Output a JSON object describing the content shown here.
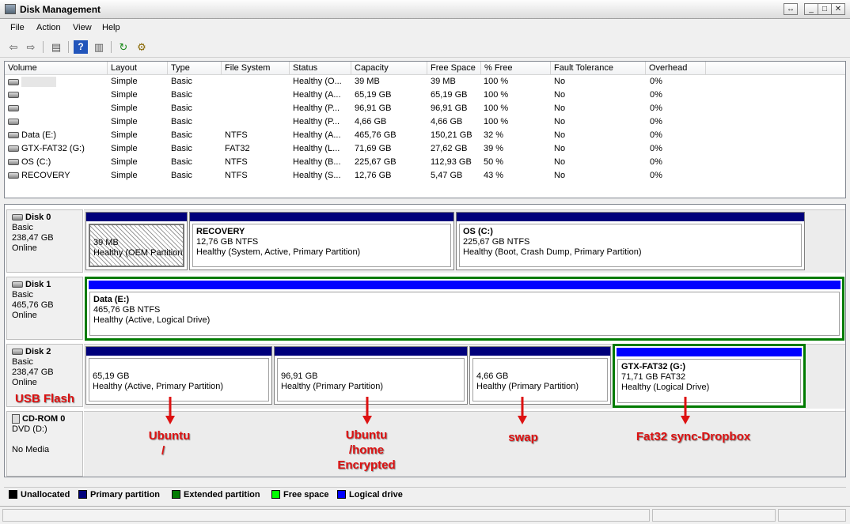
{
  "window": {
    "title": "Disk Management",
    "restore_glyph": "↔",
    "minimize_glyph": "_",
    "maximize_glyph": "□",
    "close_glyph": "✕"
  },
  "menu": [
    "File",
    "Action",
    "View",
    "Help"
  ],
  "toolbar": {
    "back_glyph": "⇦",
    "forward_glyph": "⇨",
    "console_glyph": "▤",
    "help_glyph": "?",
    "properties_glyph": "▥",
    "refresh_glyph": "↻",
    "rescan_glyph": "⚙"
  },
  "volume_table": {
    "columns": [
      "Volume",
      "Layout",
      "Type",
      "File System",
      "Status",
      "Capacity",
      "Free Space",
      "% Free",
      "Fault Tolerance",
      "Overhead"
    ],
    "rows": [
      {
        "volume": "",
        "layout": "Simple",
        "type": "Basic",
        "fs": "",
        "status": "Healthy (O...",
        "capacity": "39 MB",
        "free": "39 MB",
        "pct": "100 %",
        "fault": "No",
        "overhead": "0%"
      },
      {
        "volume": "",
        "layout": "Simple",
        "type": "Basic",
        "fs": "",
        "status": "Healthy (A...",
        "capacity": "65,19 GB",
        "free": "65,19 GB",
        "pct": "100 %",
        "fault": "No",
        "overhead": "0%"
      },
      {
        "volume": "",
        "layout": "Simple",
        "type": "Basic",
        "fs": "",
        "status": "Healthy (P...",
        "capacity": "96,91 GB",
        "free": "96,91 GB",
        "pct": "100 %",
        "fault": "No",
        "overhead": "0%"
      },
      {
        "volume": "",
        "layout": "Simple",
        "type": "Basic",
        "fs": "",
        "status": "Healthy (P...",
        "capacity": "4,66 GB",
        "free": "4,66 GB",
        "pct": "100 %",
        "fault": "No",
        "overhead": "0%"
      },
      {
        "volume": "Data (E:)",
        "layout": "Simple",
        "type": "Basic",
        "fs": "NTFS",
        "status": "Healthy (A...",
        "capacity": "465,76 GB",
        "free": "150,21 GB",
        "pct": "32 %",
        "fault": "No",
        "overhead": "0%"
      },
      {
        "volume": "GTX-FAT32 (G:)",
        "layout": "Simple",
        "type": "Basic",
        "fs": "FAT32",
        "status": "Healthy (L...",
        "capacity": "71,69 GB",
        "free": "27,62 GB",
        "pct": "39 %",
        "fault": "No",
        "overhead": "0%"
      },
      {
        "volume": "OS (C:)",
        "layout": "Simple",
        "type": "Basic",
        "fs": "NTFS",
        "status": "Healthy (B...",
        "capacity": "225,67 GB",
        "free": "112,93 GB",
        "pct": "50 %",
        "fault": "No",
        "overhead": "0%"
      },
      {
        "volume": "RECOVERY",
        "layout": "Simple",
        "type": "Basic",
        "fs": "NTFS",
        "status": "Healthy (S...",
        "capacity": "12,76 GB",
        "free": "5,47 GB",
        "pct": "43 %",
        "fault": "No",
        "overhead": "0%"
      }
    ]
  },
  "disks": [
    {
      "name": "Disk 0",
      "kind": "Basic",
      "size": "238,47 GB",
      "state": "Online",
      "partitions": [
        {
          "name": "",
          "size": "39 MB",
          "status": "Healthy (OEM Partition)"
        },
        {
          "name": "RECOVERY",
          "size": "12,76 GB NTFS",
          "status": "Healthy (System, Active, Primary Partition)"
        },
        {
          "name": "OS  (C:)",
          "size": "225,67 GB NTFS",
          "status": "Healthy (Boot, Crash Dump, Primary Partition)"
        }
      ]
    },
    {
      "name": "Disk 1",
      "kind": "Basic",
      "size": "465,76 GB",
      "state": "Online",
      "partitions": [
        {
          "name": "Data  (E:)",
          "size": "465,76 GB NTFS",
          "status": "Healthy (Active, Logical Drive)"
        }
      ]
    },
    {
      "name": "Disk 2",
      "kind": "Basic",
      "size": "238,47 GB",
      "state": "Online",
      "partitions": [
        {
          "name": "",
          "size": "65,19 GB",
          "status": "Healthy (Active, Primary Partition)"
        },
        {
          "name": "",
          "size": "96,91 GB",
          "status": "Healthy (Primary Partition)"
        },
        {
          "name": "",
          "size": "4,66 GB",
          "status": "Healthy (Primary Partition)"
        },
        {
          "name": "GTX-FAT32  (G:)",
          "size": "71,71 GB FAT32",
          "status": "Healthy (Logical Drive)"
        }
      ]
    },
    {
      "name": "CD-ROM 0",
      "kind": "DVD (D:)",
      "size": "",
      "state": "No Media",
      "partitions": []
    }
  ],
  "annotations": {
    "usb_flash": "USB Flash",
    "ubuntu_root_1": "Ubuntu",
    "ubuntu_root_2": "/",
    "ubuntu_home_1": "Ubuntu",
    "ubuntu_home_2": "/home",
    "ubuntu_home_3": "Encrypted",
    "swap": "swap",
    "fat32": "Fat32 sync-Dropbox"
  },
  "legend": [
    {
      "label": "Unallocated",
      "color": "#000000"
    },
    {
      "label": "Primary partition",
      "color": "#00007b"
    },
    {
      "label": "Extended partition",
      "color": "#007b00"
    },
    {
      "label": "Free space",
      "color": "#00ff00"
    },
    {
      "label": "Logical drive",
      "color": "#0000ff"
    }
  ],
  "colors": {
    "primary_bar": "#00007b",
    "logical_bar": "#0000ff",
    "extended_border": "#007b00",
    "annotation_red": "#dd1111"
  }
}
